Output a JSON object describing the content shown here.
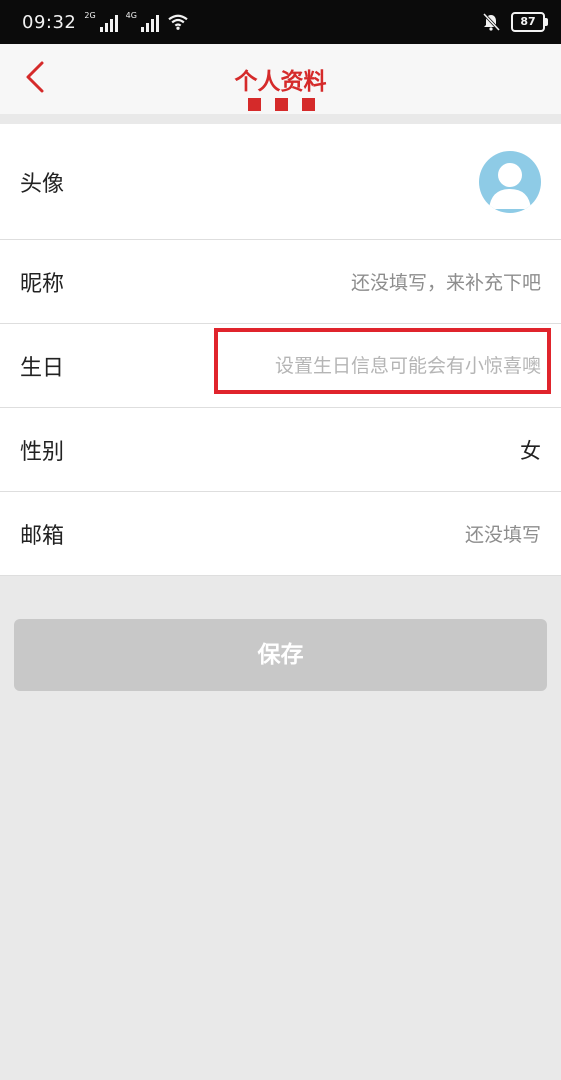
{
  "status_bar": {
    "time": "09:32",
    "sim1_tag": "2G",
    "sim2_tag": "4G",
    "battery": "87",
    "icons": [
      "signal-icon",
      "wifi-icon",
      "bell-muted-icon",
      "battery-icon"
    ]
  },
  "header": {
    "title": "个人资料",
    "back_icon": "chevron-left-icon",
    "accent_color": "#d52a2a"
  },
  "profile": {
    "avatar_label": "头像",
    "nickname_label": "昵称",
    "nickname_placeholder": "还没填写，来补充下吧",
    "birthday_label": "生日",
    "birthday_placeholder": "设置生日信息可能会有小惊喜噢",
    "gender_label": "性别",
    "gender_value": "女",
    "email_label": "邮箱",
    "email_placeholder": "还没填写"
  },
  "actions": {
    "save_label": "保存"
  },
  "colors": {
    "highlight_border": "#e0242c",
    "avatar_bg": "#8ecbe6",
    "save_disabled": "#c8c8c8"
  }
}
